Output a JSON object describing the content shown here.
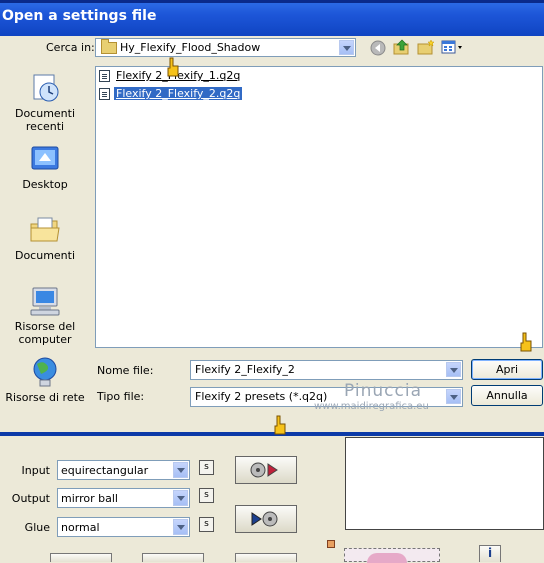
{
  "window": {
    "title": "Open a settings file"
  },
  "lookin": {
    "label": "Cerca in:",
    "value": "Hy_Flexify_Flood_Shadow"
  },
  "places": [
    {
      "label_line1": "Documenti",
      "label_line2": "recenti",
      "icon": "recent-documents-icon"
    },
    {
      "label_line1": "Desktop",
      "label_line2": "",
      "icon": "desktop-icon"
    },
    {
      "label_line1": "Documenti",
      "label_line2": "",
      "icon": "my-documents-icon"
    },
    {
      "label_line1": "Risorse del",
      "label_line2": "computer",
      "icon": "my-computer-icon"
    },
    {
      "label_line1": "Risorse di rete",
      "label_line2": "",
      "icon": "network-icon"
    }
  ],
  "files": [
    {
      "name": "Flexify 2_Flexify_1.q2q",
      "selected": false
    },
    {
      "name": "Flexify 2_Flexify_2.q2q",
      "selected": true
    }
  ],
  "filename": {
    "label": "Nome file:",
    "value": "Flexify 2_Flexify_2"
  },
  "filetype": {
    "label": "Tipo file:",
    "value": "Flexify 2 presets (*.q2q)"
  },
  "buttons": {
    "open": "Apri",
    "cancel": "Annulla"
  },
  "watermark": {
    "name": "Pinuccia",
    "url": "www.maidiregrafica.eu"
  },
  "panel": {
    "input": {
      "label": "Input",
      "value": "equirectangular",
      "s": "s"
    },
    "output": {
      "label": "Output",
      "value": "mirror ball",
      "s": "s"
    },
    "glue": {
      "label": "Glue",
      "value": "normal",
      "s": "s"
    },
    "info": "i"
  },
  "colors": {
    "titlebar": "#0f44c2",
    "selection": "#316ac5",
    "dialog_bg": "#ece9d8"
  }
}
